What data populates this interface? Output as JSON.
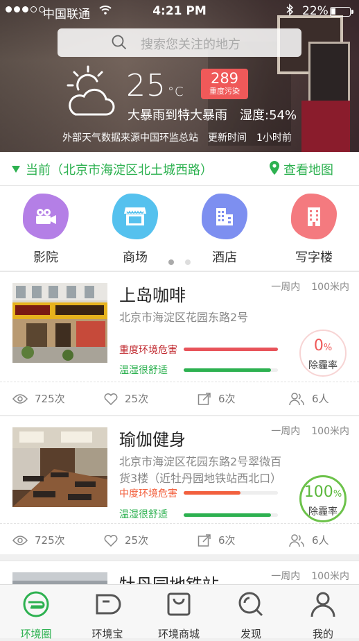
{
  "status_bar": {
    "carrier": "中国联通",
    "time": "4:21 PM",
    "battery": "22%"
  },
  "search": {
    "placeholder": "搜索您关注的地方"
  },
  "weather": {
    "temperature": "25",
    "unit": "°C",
    "aqi_value": "289",
    "aqi_label": "重度污染",
    "condition": "大暴雨到特大暴雨",
    "humidity": "湿度:54%",
    "source": "外部天气数据来源中国环监总站",
    "update_label": "更新时间",
    "update_value": "1小时前"
  },
  "location": {
    "current": "当前（北京市海淀区北土城西路）",
    "map_link": "查看地图"
  },
  "categories": [
    {
      "label": "影院",
      "icon": "camera-icon",
      "color": "#b47fe6"
    },
    {
      "label": "商场",
      "icon": "store-icon",
      "color": "#55c1ee"
    },
    {
      "label": "酒店",
      "icon": "hotel-icon",
      "color": "#7d8ff0"
    },
    {
      "label": "写字楼",
      "icon": "office-icon",
      "color": "#f47a7f"
    }
  ],
  "cards": [
    {
      "title": "上岛咖啡",
      "time": "一周内",
      "distance": "100米内",
      "address": "北京市海淀区花园东路2号",
      "hazard": "重度环境危害",
      "hazard_level": 1.0,
      "hazard_color": "#e8535a",
      "comfort": "温湿很舒适",
      "comfort_level": 0.93,
      "rate_value": "0",
      "rate_unit": "%",
      "rate_label": "除霾率",
      "rate": 0,
      "views": "725次",
      "likes": "25次",
      "shares": "6次",
      "people": "6人"
    },
    {
      "title": "瑜伽健身",
      "time": "一周内",
      "distance": "100米内",
      "address": "北京市海淀区花园东路2号翠微百货3楼（近牡丹园地铁站西北口）",
      "hazard": "中度环境危害",
      "hazard_level": 0.6,
      "hazard_color": "#f2603e",
      "comfort": "温湿很舒适",
      "comfort_level": 0.93,
      "rate_value": "100",
      "rate_unit": "%",
      "rate_label": "除霾率",
      "rate": 100,
      "views": "725次",
      "likes": "25次",
      "shares": "6次",
      "people": "6人"
    },
    {
      "title": "牡丹园地铁站",
      "time": "一周内",
      "distance": "100米内"
    }
  ],
  "tabs": [
    {
      "label": "环境圈",
      "icon": "eco-circle-icon",
      "active": true
    },
    {
      "label": "环境宝",
      "icon": "device-icon",
      "active": false
    },
    {
      "label": "环境商城",
      "icon": "shopping-bag-icon",
      "active": false
    },
    {
      "label": "发现",
      "icon": "discover-search-icon",
      "active": false
    },
    {
      "label": "我的",
      "icon": "profile-icon",
      "active": false
    }
  ],
  "colors": {
    "accent": "#2db150",
    "aqi_bad": "#ef5959"
  }
}
